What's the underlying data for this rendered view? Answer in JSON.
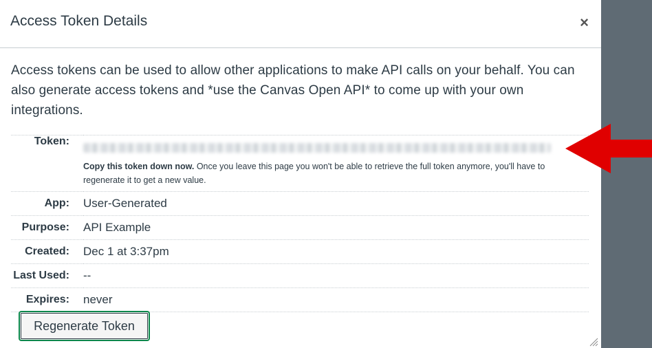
{
  "dialog": {
    "title": "Access Token Details",
    "close_label": "×",
    "intro": "Access tokens can be used to allow other applications to make API calls on your behalf. You can also generate access tokens and *use the Canvas Open API* to come up with your own integrations."
  },
  "details": {
    "token_label": "Token:",
    "token_warning_strong": "Copy this token down now.",
    "token_warning_rest": " Once you leave this page you won't be able to retrieve the full token anymore, you'll have to regenerate it to get a new value.",
    "app_label": "App:",
    "app_value": "User-Generated",
    "purpose_label": "Purpose:",
    "purpose_value": "API Example",
    "created_label": "Created:",
    "created_value": "Dec 1 at 3:37pm",
    "last_used_label": "Last Used:",
    "last_used_value": "--",
    "expires_label": "Expires:",
    "expires_value": "never"
  },
  "actions": {
    "regenerate_label": "Regenerate Token"
  },
  "colors": {
    "arrow": "#e00000",
    "button_border": "#0b874b",
    "backdrop": "#5f6b74"
  },
  "icons": {
    "close": "close-icon",
    "resize": "resize-handle-icon",
    "arrow": "red-arrow-annotation"
  }
}
